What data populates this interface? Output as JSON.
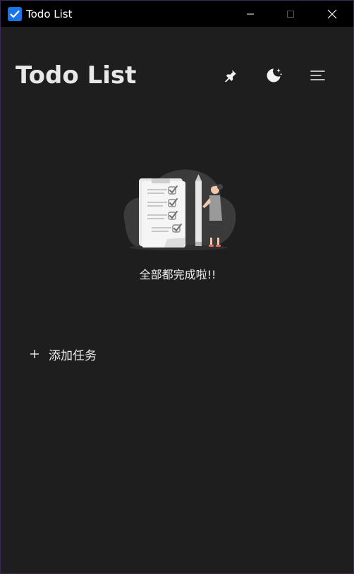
{
  "window": {
    "title": "Todo List"
  },
  "header": {
    "title": "Todo List",
    "icons": [
      "pin-icon",
      "moon-stars-icon",
      "menu-icon"
    ]
  },
  "empty_state": {
    "message": "全部都完成啦!!"
  },
  "add_task": {
    "label": "添加任务",
    "icon": "plus-icon"
  },
  "colors": {
    "background": "#1e1e1e",
    "titlebar": "#000000",
    "app_icon": "#1a73e8",
    "text": "#f0f0f0"
  }
}
